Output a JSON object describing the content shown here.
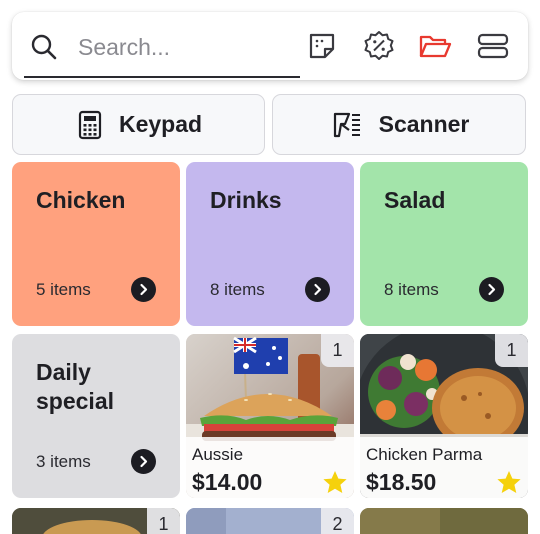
{
  "search": {
    "placeholder": "Search..."
  },
  "toolbar": {
    "icons": [
      "search-icon",
      "sticky-note-icon",
      "discount-badge-icon",
      "folder-open-icon",
      "layout-toggle-icon"
    ],
    "active_color": "#e8392f"
  },
  "modes": [
    {
      "label": "Keypad",
      "icon": "calculator-icon"
    },
    {
      "label": "Scanner",
      "icon": "barcode-scanner-icon"
    }
  ],
  "categories": [
    {
      "name": "Chicken",
      "count": "5 items",
      "color": "#ffa17e"
    },
    {
      "name": "Drinks",
      "count": "8 items",
      "color": "#c4b8ee"
    },
    {
      "name": "Salad",
      "count": "8 items",
      "color": "#a3e4aa"
    },
    {
      "name": "Daily special",
      "count": "3 items",
      "color": "#dddde0"
    }
  ],
  "products": [
    {
      "name": "Aussie",
      "price": "$14.00",
      "qty": "1",
      "favorite": true
    },
    {
      "name": "Chicken Parma",
      "price": "$18.50",
      "qty": "1",
      "favorite": true
    }
  ],
  "partial_row": [
    {
      "qty": "1"
    },
    {
      "qty": "2"
    },
    {
      "qty": ""
    }
  ],
  "colors": {
    "star": "#f5d10c",
    "arrow_button": "#1c1c22"
  }
}
